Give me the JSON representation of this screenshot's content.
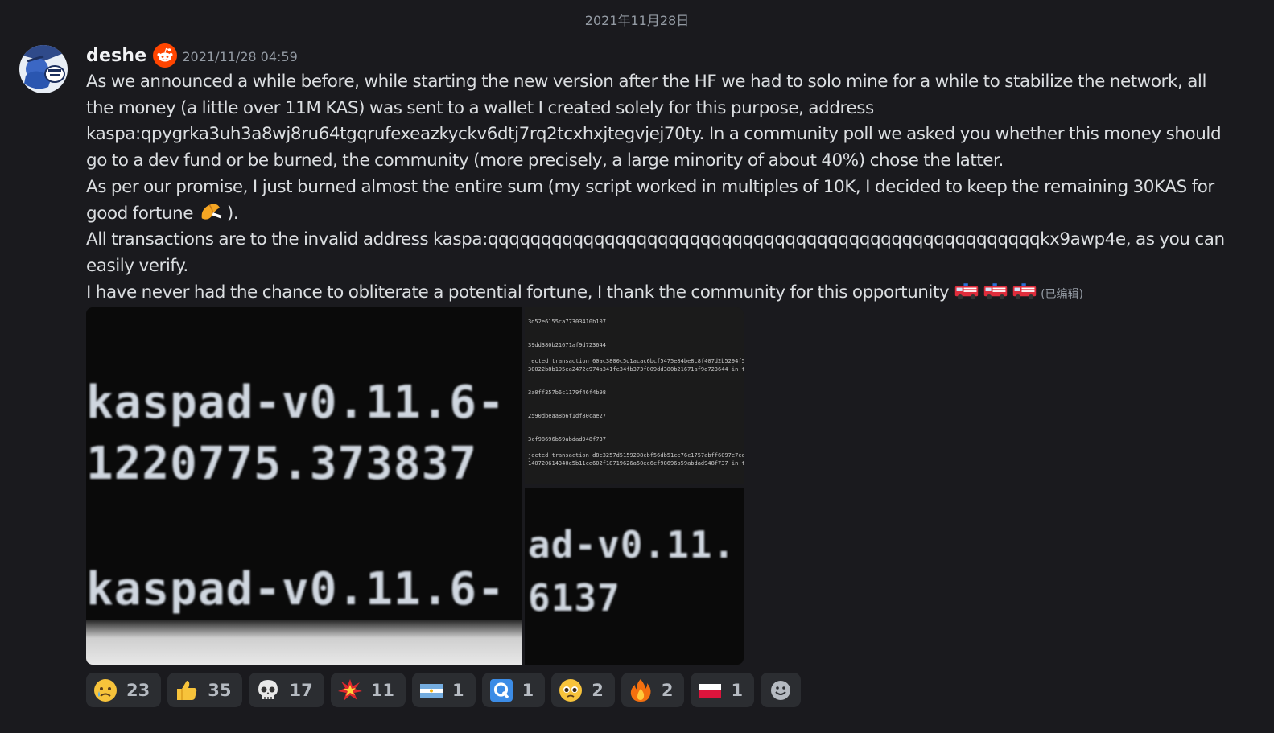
{
  "date_divider": "2021年11月28日",
  "author": {
    "username": "deshe",
    "timestamp": "2021/11/28 04:59",
    "badge_icon": "reddit-alien-icon"
  },
  "message": {
    "p1": "As we announced a while before, while starting the new version after the HF we had to solo mine for a while to stabilize the network, all the money (a little over 11M KAS) was sent to a wallet I created solely for this purpose, address kaspa:qpygrka3uh3a8wj8ru64tgqrufexeazkyckv6dtj7rq2tcxhxjtegvjej70ty. In a community poll we asked you whether this money should go to a dev fund or be burned, the community (more precisely, a large minority of about 40%) chose the latter.",
    "p2_before": "As per our promise, I just burned almost the entire sum (my script worked in multiples of 10K, I decided to keep the remaining 30KAS for good fortune ",
    "p2_after": ").",
    "p3": "All transactions are to the invalid address kaspa:qqqqqqqqqqqqqqqqqqqqqqqqqqqqqqqqqqqqqqqqqqqqqqqqqqqqkx9awp4e, as you can easily verify.",
    "p4": "I have never had the chance to obliterate a potential fortune, I thank the community for this opportunity ",
    "edited": "(已编辑)"
  },
  "attachments": {
    "main_line1": "kaspad-v0.11.6-",
    "main_line2": "1220775.373837",
    "main_line3": "kaspad-v0.11.6-",
    "log_lines": [
      "3d52e6155ca77303410b107",
      "39dd380b21671af9d723644",
      "jected transaction 60ac3800c5d1acac6bcf5475e84be8c8f407d2b5294f523a",
      "30022b8b195ea2472c974a341fe34fb373f009dd380b21671af9d723644 in the m",
      "3a0ff357b6c1179f46f4b98",
      "2590dbeaa8b6f1df80cae27",
      "3cf98696b59abdad948f737",
      "jected transaction d8c3257d5159208cbf56db51ce76c1757abff6097e7cefa1",
      "140720614340e5b11ce602f18719626a50ee6cf98696b59abdad948f737 in the m"
    ],
    "zoom_line1": "ad-v0.11.",
    "zoom_line2": "6137"
  },
  "reactions": [
    {
      "icon": "crying-face-icon",
      "count": "23"
    },
    {
      "icon": "thumbs-up-icon",
      "count": "35"
    },
    {
      "icon": "skull-icon",
      "count": "17"
    },
    {
      "icon": "collision-icon",
      "count": "11"
    },
    {
      "icon": "argentina-flag-icon",
      "count": "1"
    },
    {
      "icon": "q-letter-icon",
      "count": "1"
    },
    {
      "icon": "pleading-face-icon",
      "count": "2"
    },
    {
      "icon": "fire-icon",
      "count": "2"
    },
    {
      "icon": "poland-flag-icon",
      "count": "1"
    }
  ],
  "colors": {
    "background": "#1a1a1e",
    "text": "#dbdee1",
    "muted": "#949ba4",
    "reaction_bg": "#2b2d31",
    "badge": "#ff4500"
  }
}
